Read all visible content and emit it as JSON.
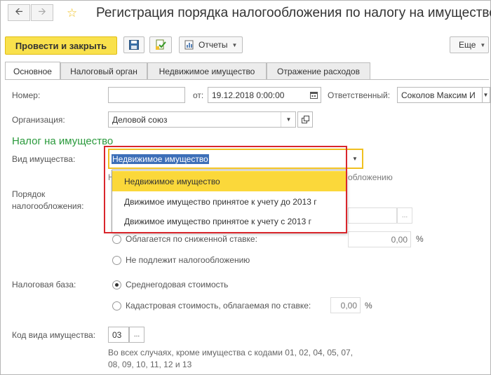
{
  "window": {
    "title": "Регистрация порядка налогообложения по налогу на имущество"
  },
  "toolbar": {
    "post_close_label": "Провести и закрыть",
    "reports_label": "Отчеты",
    "more_label": "Еще"
  },
  "tabs": [
    {
      "label": "Основное"
    },
    {
      "label": "Налоговый орган"
    },
    {
      "label": "Недвижимое имущество"
    },
    {
      "label": "Отражение расходов"
    }
  ],
  "form": {
    "number_label": "Номер:",
    "number_value": "",
    "date_label": "от:",
    "date_value": "19.12.2018  0:00:00",
    "responsible_label": "Ответственный:",
    "responsible_value": "Соколов Максим И",
    "organization_label": "Организация:",
    "organization_value": "Деловой союз",
    "section_title": "Налог на имущество",
    "property_type_label": "Вид имущества:",
    "property_type_value": "Недвижимое имущество",
    "property_type_options": [
      "Недвижимое имущество",
      "Движимое имущество принятое к учету до 2013 г",
      "Движимое имущество принятое к учету с 2013 г"
    ],
    "behind_hint_start": "Н",
    "behind_hint_end": "обложению",
    "taxation_order_label_1": "Порядок",
    "taxation_order_label_2": "налогообложения:",
    "reduced_rate_label": "Облагается по сниженной ставке:",
    "reduced_rate_value": "0,00",
    "percent": "%",
    "not_taxable_label": "Не подлежит налогообложению",
    "tax_base_label": "Налоговая база:",
    "avg_annual_label": "Среднегодовая стоимость",
    "cadastral_label": "Кадастровая стоимость, облагаемая по ставке:",
    "cadastral_value": "0,00",
    "property_code_label": "Код вида имущества:",
    "property_code_value": "03",
    "code_hint_1": "Во всех случаях, кроме имущества с кодами 01, 02, 04, 05, 07,",
    "code_hint_2": "08, 09, 10, 11, 12 и 13"
  },
  "colors": {
    "accent_yellow": "#f9e14c",
    "highlight_yellow": "#fbd83a",
    "section_green": "#2a9a3c",
    "annotation_red": "#d9262c",
    "selection_blue": "#3d6fb8"
  }
}
